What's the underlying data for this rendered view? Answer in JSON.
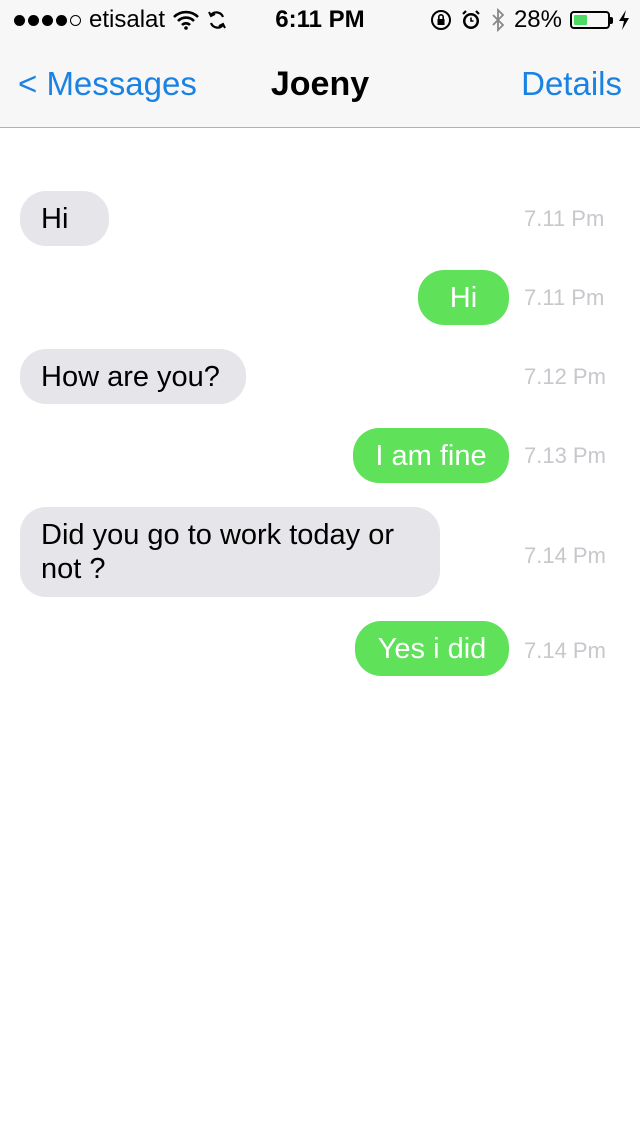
{
  "status_bar": {
    "signal": "●●●●○",
    "carrier": "etisalat",
    "time": "6:11 PM",
    "battery_percent": "28%",
    "battery_level": 0.28,
    "icons": [
      "wifi-icon",
      "sync-icon",
      "orientation-lock-icon",
      "alarm-icon",
      "bluetooth-icon",
      "battery-icon",
      "charging-icon"
    ]
  },
  "nav": {
    "back_label": "< Messages",
    "title": "Joeny",
    "details_label": "Details"
  },
  "colors": {
    "accent": "#1a82e2",
    "incoming_bubble": "#e5e5ea",
    "outgoing_bubble": "#5fe15a",
    "timestamp": "#c7c7cc"
  },
  "messages": [
    {
      "direction": "incoming",
      "text": "Hi",
      "time": "7.11 Pm"
    },
    {
      "direction": "outgoing",
      "text": "Hi",
      "time": "7.11 Pm"
    },
    {
      "direction": "incoming",
      "text": "How are you?",
      "time": "7.12 Pm"
    },
    {
      "direction": "outgoing",
      "text": "I am fine",
      "time": "7.13 Pm"
    },
    {
      "direction": "incoming",
      "text": "Did you go to work today or not ?",
      "time": "7.14 Pm"
    },
    {
      "direction": "outgoing",
      "text": "Yes i did",
      "time": "7.14 Pm"
    }
  ]
}
